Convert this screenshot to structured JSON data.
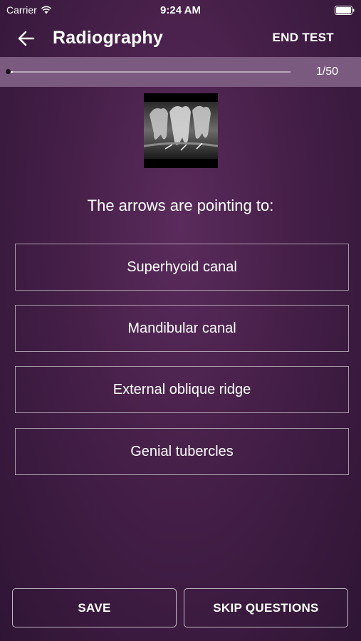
{
  "status_bar": {
    "carrier": "Carrier",
    "time": "9:24 AM",
    "wifi_icon": "wifi-icon",
    "battery_icon": "battery-icon"
  },
  "nav": {
    "back_icon": "arrow-left-icon",
    "title": "Radiography",
    "end_test_label": "END TEST"
  },
  "progress": {
    "fraction": 0.02,
    "label": "1/50"
  },
  "question": {
    "image_icon": "dental-radiograph-image",
    "text": "The arrows are pointing to:"
  },
  "options": [
    {
      "label": "Superhyoid canal"
    },
    {
      "label": "Mandibular canal"
    },
    {
      "label": "External oblique ridge"
    },
    {
      "label": "Genial tubercles"
    }
  ],
  "actions": {
    "save_label": "SAVE",
    "skip_label": "SKIP QUESTIONS"
  },
  "colors": {
    "background": "#451f48",
    "progress_strip": "#7b5a7f",
    "text": "#ffffff"
  }
}
